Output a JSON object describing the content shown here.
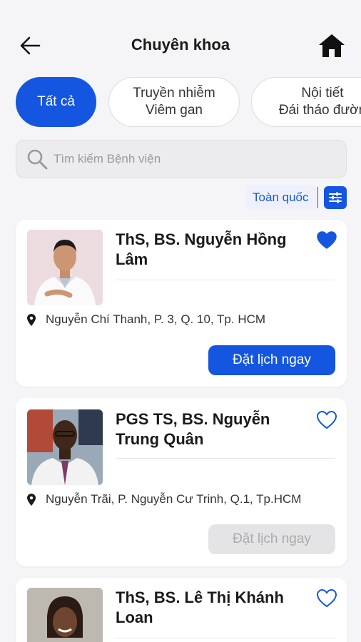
{
  "header": {
    "title": "Chuyên khoa"
  },
  "chips": [
    {
      "line1": "Tất cả",
      "line2": ""
    },
    {
      "line1": "Truyền nhiễm",
      "line2": "Viêm gan"
    },
    {
      "line1": "Nội tiết",
      "line2": "Đái tháo đườn"
    }
  ],
  "search": {
    "placeholder": "Tìm kiếm Bệnh viện"
  },
  "region": {
    "label": "Toàn quốc"
  },
  "doctors": [
    {
      "name": "ThS, BS. Nguyễn Hồng Lâm",
      "address": "Nguyễn Chí Thanh, P. 3, Q. 10, Tp. HCM",
      "book_label": "Đặt lịch ngay",
      "favorited": true,
      "book_enabled": true
    },
    {
      "name": "PGS TS, BS. Nguyễn Trung Quân",
      "address": "Nguyễn Trãi, P. Nguyễn Cư Trinh, Q.1, Tp.HCM",
      "book_label": "Đặt lịch ngay",
      "favorited": false,
      "book_enabled": false
    },
    {
      "name": "ThS, BS. Lê Thị Khánh Loan",
      "address": "",
      "book_label": "",
      "favorited": false,
      "book_enabled": true
    }
  ],
  "colors": {
    "primary": "#1456e0",
    "background": "#f5f5f7",
    "disabled": "#e4e4e6"
  },
  "icons": {
    "back": "arrow-left-icon",
    "home": "home-icon",
    "search": "search-icon",
    "filter": "sliders-icon",
    "favorite": "heart-icon",
    "location": "map-pin-icon"
  }
}
